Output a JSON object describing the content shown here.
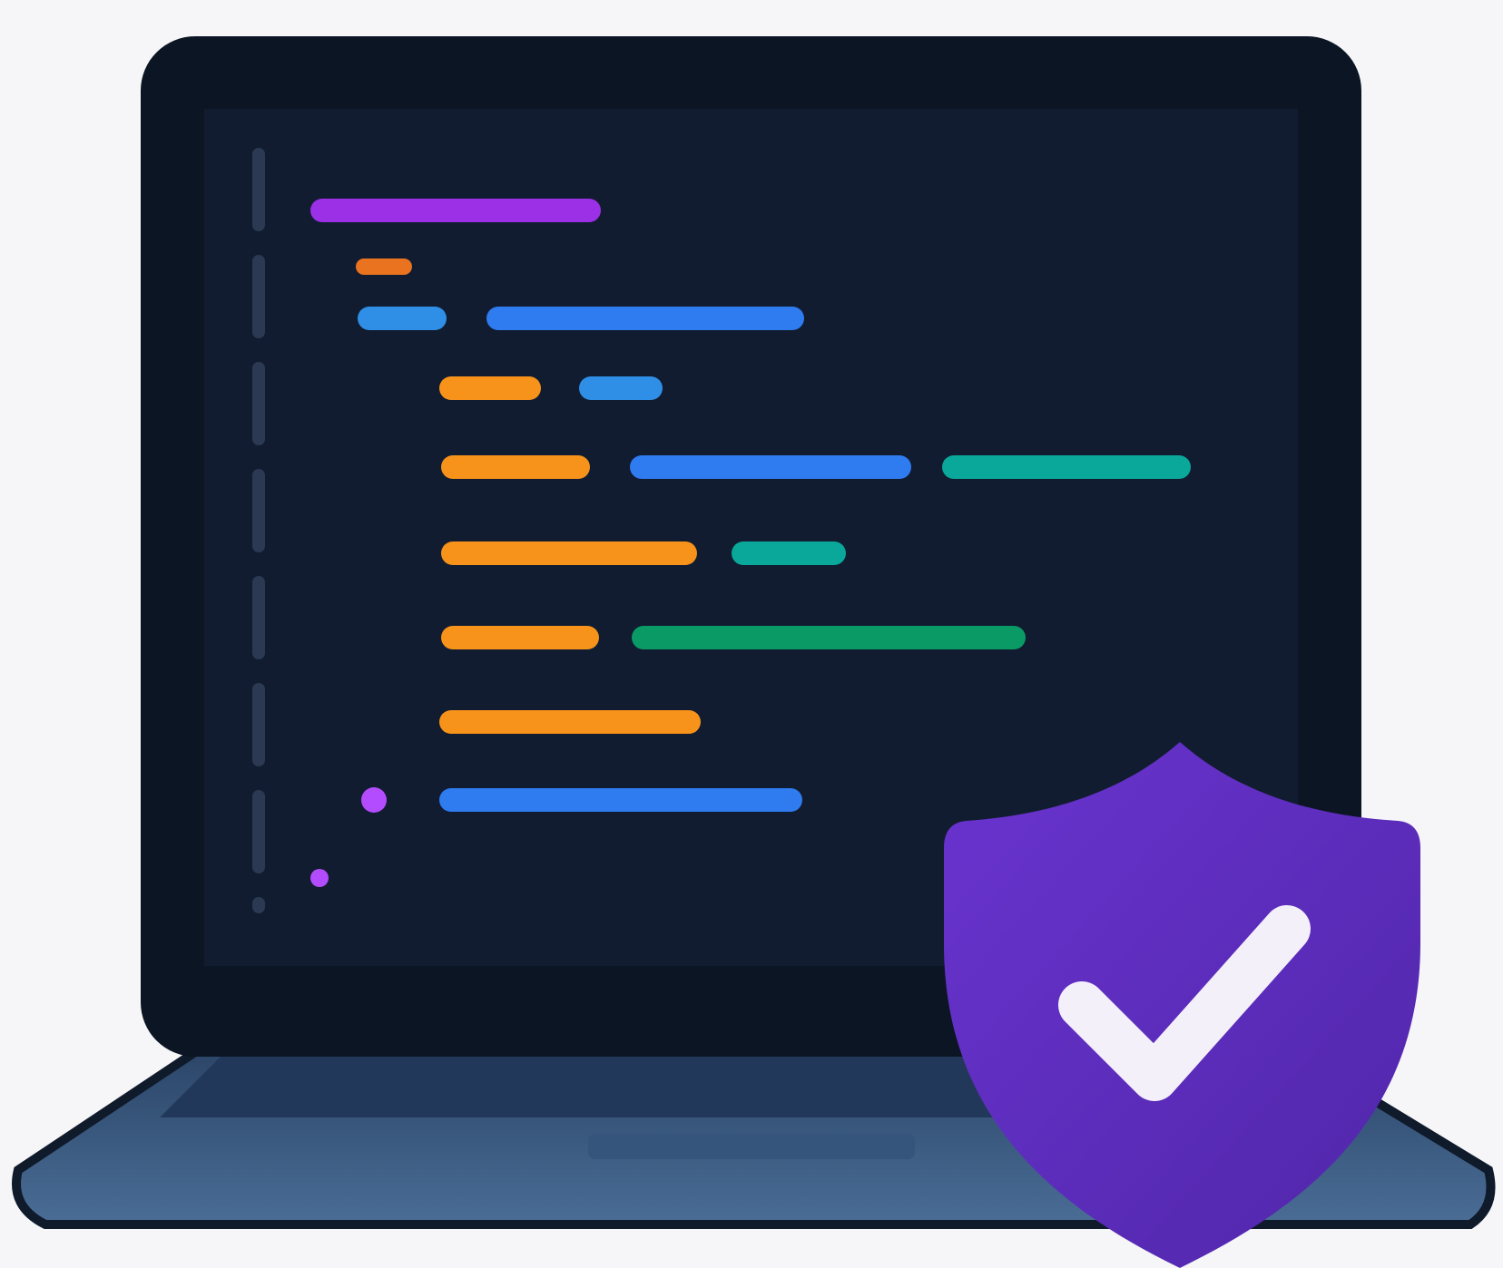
{
  "colors": {
    "background": "#f6f6f8",
    "laptop_lid": "#0c1524",
    "screen": "#111c30",
    "gutter": "#2b3a52",
    "keyboard_deck": "#3f5f86",
    "keyboard_deck_dark": "#233a58",
    "trackpad": "#3a5a80",
    "shield": "#5a30b8",
    "checkmark": "#f4f0fa"
  },
  "icons": {
    "laptop": "laptop-icon",
    "shield": "shield-check-icon"
  },
  "code_lines": [
    {
      "tokens": [
        {
          "color": "#9b30e6"
        }
      ]
    },
    {
      "tokens": [
        {
          "color": "#e9731e"
        }
      ]
    },
    {
      "tokens": [
        {
          "color": "#2f8fe6"
        },
        {
          "color": "#2f7bf0"
        }
      ]
    },
    {
      "tokens": [
        {
          "color": "#f7931a"
        },
        {
          "color": "#2f8fe6"
        }
      ]
    },
    {
      "tokens": [
        {
          "color": "#f7931a"
        },
        {
          "color": "#2f7bf0"
        },
        {
          "color": "#0aa89a"
        }
      ]
    },
    {
      "tokens": [
        {
          "color": "#f7931a"
        },
        {
          "color": "#0aa89a"
        }
      ]
    },
    {
      "tokens": [
        {
          "color": "#f7931a"
        },
        {
          "color": "#0a9a66"
        }
      ]
    },
    {
      "tokens": [
        {
          "color": "#f7931a"
        }
      ]
    },
    {
      "tokens": [
        {
          "color": "#b34cff"
        },
        {
          "color": "#2f7bf0"
        }
      ]
    },
    {
      "tokens": [
        {
          "color": "#b34cff"
        }
      ]
    }
  ]
}
